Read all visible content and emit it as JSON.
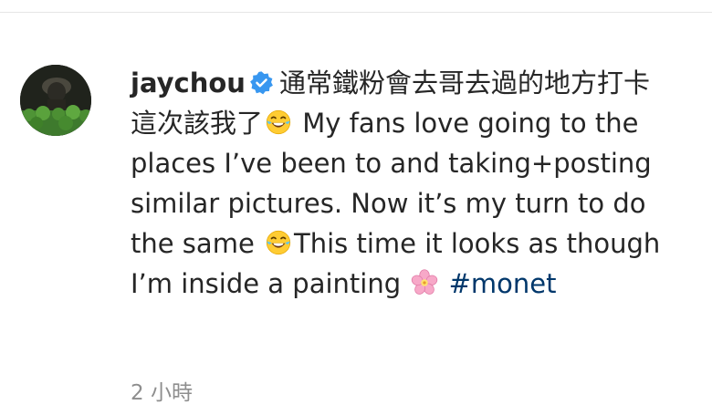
{
  "comment": {
    "username": "jaychou",
    "caption_line_chinese_1": "通常鐵粉會去哥去過的地方打卡",
    "caption_line_chinese_2": "這次該我了",
    "caption_en_1": "My fans love going to the places I’ve been to and taking+posting similar pictures. Now it’s my turn to do the same",
    "caption_en_2": "This time it looks as though I’m inside a painting",
    "hashtag": "#monet",
    "timestamp": "2 小時"
  },
  "icons": {
    "verified": "verified-badge-icon",
    "emoji_laugh": "face-with-tears-of-joy-icon",
    "emoji_flower": "cherry-blossom-icon"
  },
  "colors": {
    "text": "#262626",
    "hashtag": "#00376b",
    "verified": "#3897f0",
    "meta": "#8e8e8e"
  }
}
